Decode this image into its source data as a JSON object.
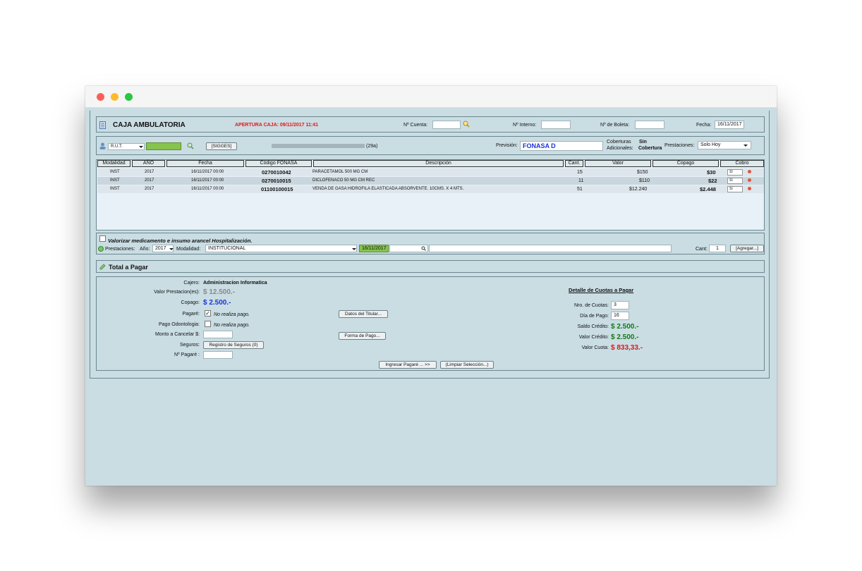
{
  "header": {
    "title": "CAJA AMBULATORIA",
    "apertura": "APERTURA CAJA: 09/11/2017 11:41",
    "cuenta_label": "Nº Cuenta:",
    "interno_label": "Nº Interno:",
    "boleta_label": "Nº de Boleta:",
    "fecha_label": "Fecha:",
    "fecha_value": "16/11/2017"
  },
  "patient": {
    "rut_type": "R.U.T.",
    "sigges_button": "[SIGGES]",
    "age": "(29a)",
    "prevision_label": "Previsión:",
    "prevision_value": "FONASA D",
    "coberturas_label": "Coberturas",
    "adicionales_label": "Adicionales:",
    "cobertura_value_1": "Sin",
    "cobertura_value_2": "Cobertura",
    "prestaciones_label": "Prestaciones:",
    "prestaciones_value": "Solo Hoy"
  },
  "table": {
    "headers": [
      "Modalidad",
      "AÑO",
      "Fecha",
      "Código FONASA",
      "Descripción",
      "Cant.",
      "Valor",
      "Copago",
      "Cobro"
    ],
    "rows": [
      {
        "modalidad": "INST",
        "ano": "2017",
        "fecha": "16/11/2017 00:00",
        "codigo": "0270010042",
        "descripcion": "PARACETAMOL 500 MG CM",
        "cant": "15",
        "valor": "$150",
        "copago": "$30",
        "cobro": "SI"
      },
      {
        "modalidad": "INST",
        "ano": "2017",
        "fecha": "16/11/2017 00:00",
        "codigo": "0270010015",
        "descripcion": "DICLOFENACO 50 MG CM REC",
        "cant": "11",
        "valor": "$110",
        "copago": "$22",
        "cobro": "SI"
      },
      {
        "modalidad": "INST",
        "ano": "2017",
        "fecha": "16/11/2017 00:00",
        "codigo": "01100100015",
        "descripcion": "VENDA DE GASA HIDROFILA ELASTICADA ABSORVENTE. 10CMS. X 4 MTS.",
        "cant": "51",
        "valor": "$12.240",
        "copago": "$2.448",
        "cobro": "SI"
      }
    ]
  },
  "add_section": {
    "valorizar_label": "Valorizar medicamento e insumo arancel Hospitalización.",
    "prestaciones_label": "Prestaciones:",
    "ano_label": "Año:",
    "ano_value": "2017",
    "modalidad_label": "Modalidad:",
    "modalidad_value": "INSTITUCIONAL",
    "fecha_value": "16/11/2017",
    "cant_label": "Cant:",
    "cant_value": "1",
    "agregar_button": "[Agregar...]"
  },
  "total": {
    "title": "Total a Pagar"
  },
  "payment": {
    "cajero_label": "Cajero:",
    "cajero_value": "Administracion Informatica",
    "valor_prest_label": "Valor Prestacion(es):",
    "valor_prest_value": "$ 12.500.-",
    "copago_label": "Copago:",
    "copago_value": "$ 2.500.-",
    "pagare_label": "Pagaré:",
    "pagare_note": "No realiza pago.",
    "odonto_label": "Pago Odontologia:",
    "odonto_note": "No realiza pago.",
    "monto_label": "Monto a Cancelar $:",
    "seguros_label": "Seguros:",
    "seguros_button": "Registro de Seguros (0)",
    "npagare_label": "Nº Pagaré :",
    "datos_button": "Datos del Titular...",
    "forma_button": "Forma de Pago...",
    "ingresar_button": "Ingresar Pagaré ... >>",
    "limpiar_button": "(Limpiar Selección...)"
  },
  "cuotas": {
    "title": "Detalle de Cuotas a Pagar",
    "nro_label": "Nro. de Cuotas:",
    "nro_value": "3",
    "dia_label": "Día de Pago:",
    "dia_value": "16",
    "saldo_label": "Saldo Crédito:",
    "saldo_value": "$ 2.500.-",
    "valor_credito_label": "Valor Crédito:",
    "valor_credito_value": "$ 2.500.-",
    "valor_cuota_label": "Valor Cuota:",
    "valor_cuota_value": "$ 833,33.-"
  }
}
